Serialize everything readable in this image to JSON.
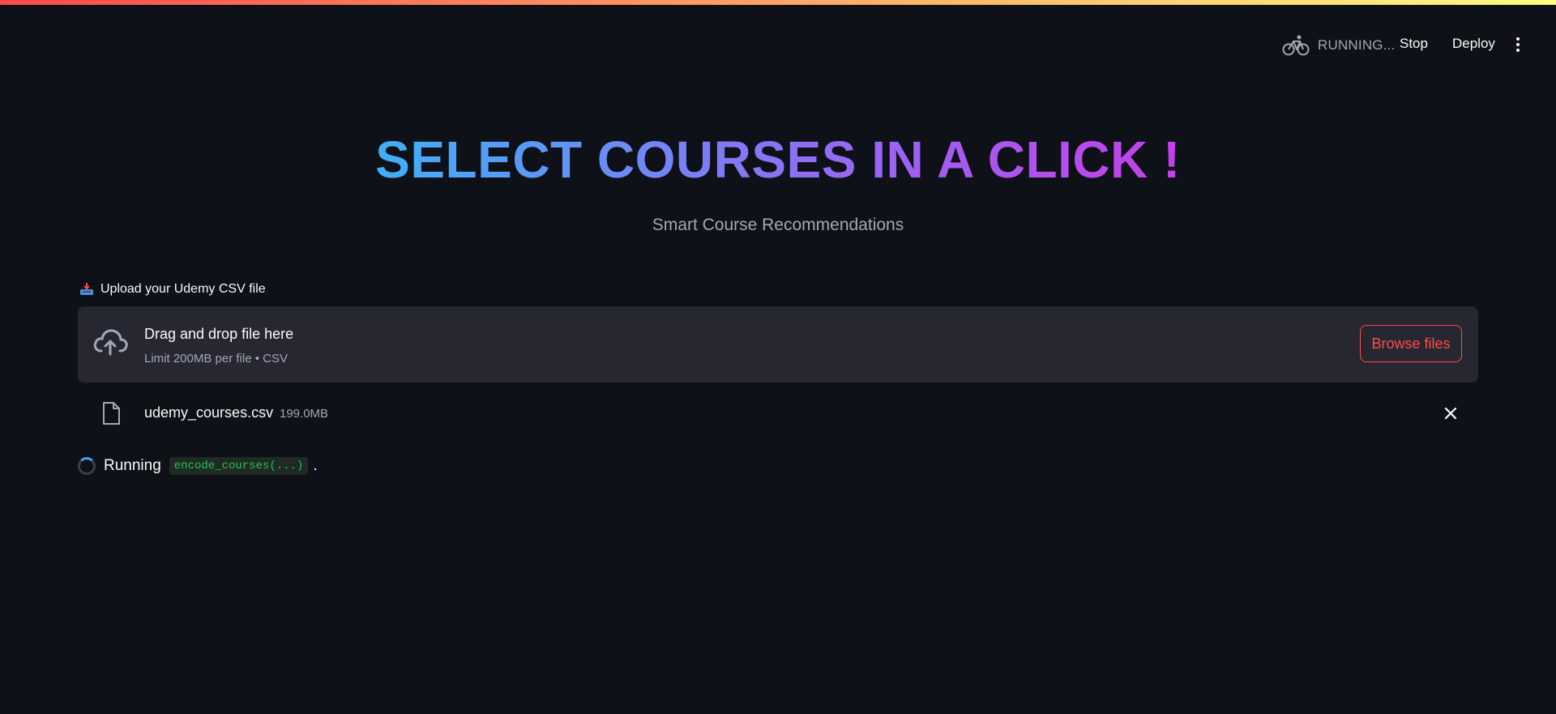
{
  "header": {
    "status_text": "RUNNING...",
    "stop_label": "Stop",
    "deploy_label": "Deploy",
    "status_icon": "bicycle-icon",
    "menu_icon": "kebab-menu-icon"
  },
  "main": {
    "title": "SELECT COURSES IN A CLICK !",
    "subtitle": "Smart Course Recommendations"
  },
  "uploader": {
    "label_icon": "inbox-tray-icon",
    "label": "Upload your Udemy CSV file",
    "drop_title": "Drag and drop file here",
    "drop_subtitle": "Limit 200MB per file • CSV",
    "browse_label": "Browse files",
    "cloud_icon": "cloud-upload-icon"
  },
  "file": {
    "name": "udemy_courses.csv",
    "size": "199.0MB",
    "file_icon": "file-icon",
    "remove_icon": "close-icon"
  },
  "status": {
    "running_label": "Running",
    "function_call": "encode_courses(...)",
    "suffix": "."
  },
  "colors": {
    "background": "#0e1117",
    "accent": "#ff4b4b",
    "title_gradient_start": "#3fb0f7",
    "title_gradient_end": "#c53fe8",
    "code_text": "#21c354"
  }
}
